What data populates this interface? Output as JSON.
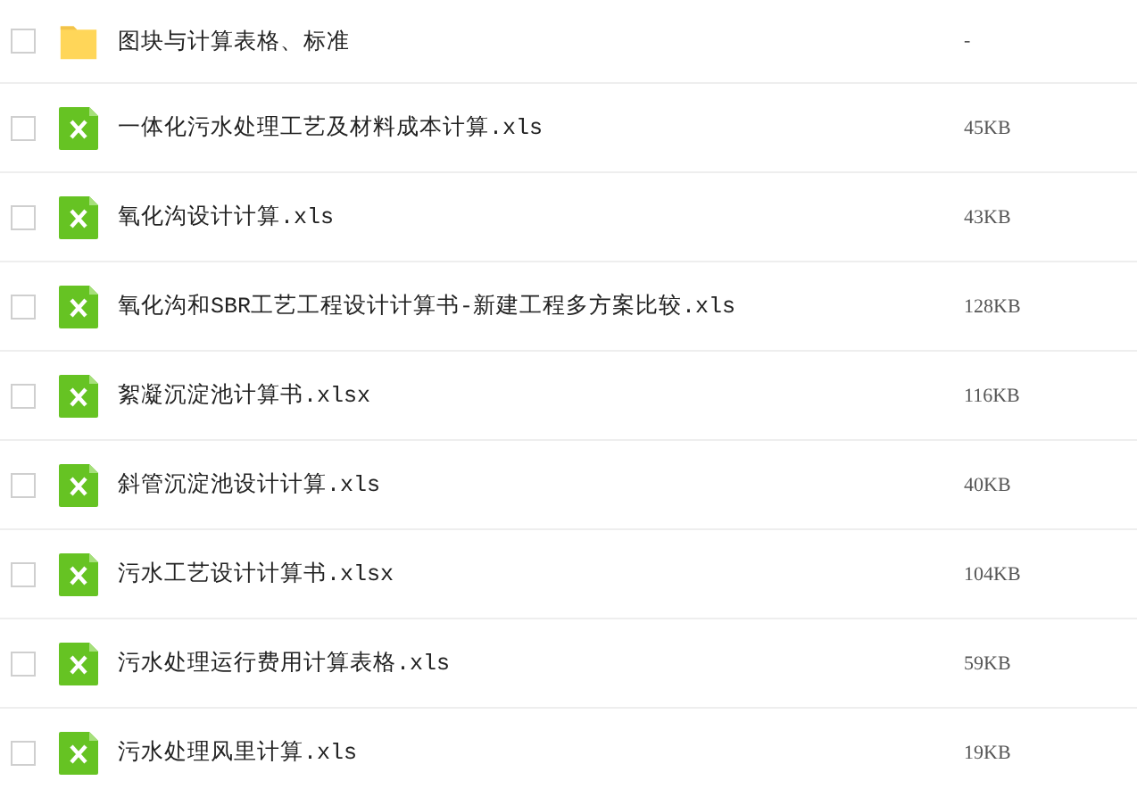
{
  "files": [
    {
      "kind": "folder",
      "name": "图块与计算表格、标准",
      "size": "-",
      "checked": false
    },
    {
      "kind": "excel",
      "name": "一体化污水处理工艺及材料成本计算.xls",
      "size": "45KB",
      "checked": false
    },
    {
      "kind": "excel",
      "name": "氧化沟设计计算.xls",
      "size": "43KB",
      "checked": false
    },
    {
      "kind": "excel",
      "name": "氧化沟和SBR工艺工程设计计算书-新建工程多方案比较.xls",
      "size": "128KB",
      "checked": false
    },
    {
      "kind": "excel",
      "name": "絮凝沉淀池计算书.xlsx",
      "size": "116KB",
      "checked": false
    },
    {
      "kind": "excel",
      "name": "斜管沉淀池设计计算.xls",
      "size": "40KB",
      "checked": false
    },
    {
      "kind": "excel",
      "name": "污水工艺设计计算书.xlsx",
      "size": "104KB",
      "checked": false
    },
    {
      "kind": "excel",
      "name": "污水处理运行费用计算表格.xls",
      "size": "59KB",
      "checked": false
    },
    {
      "kind": "excel",
      "name": "污水处理风里计算.xls",
      "size": "19KB",
      "checked": false
    }
  ]
}
